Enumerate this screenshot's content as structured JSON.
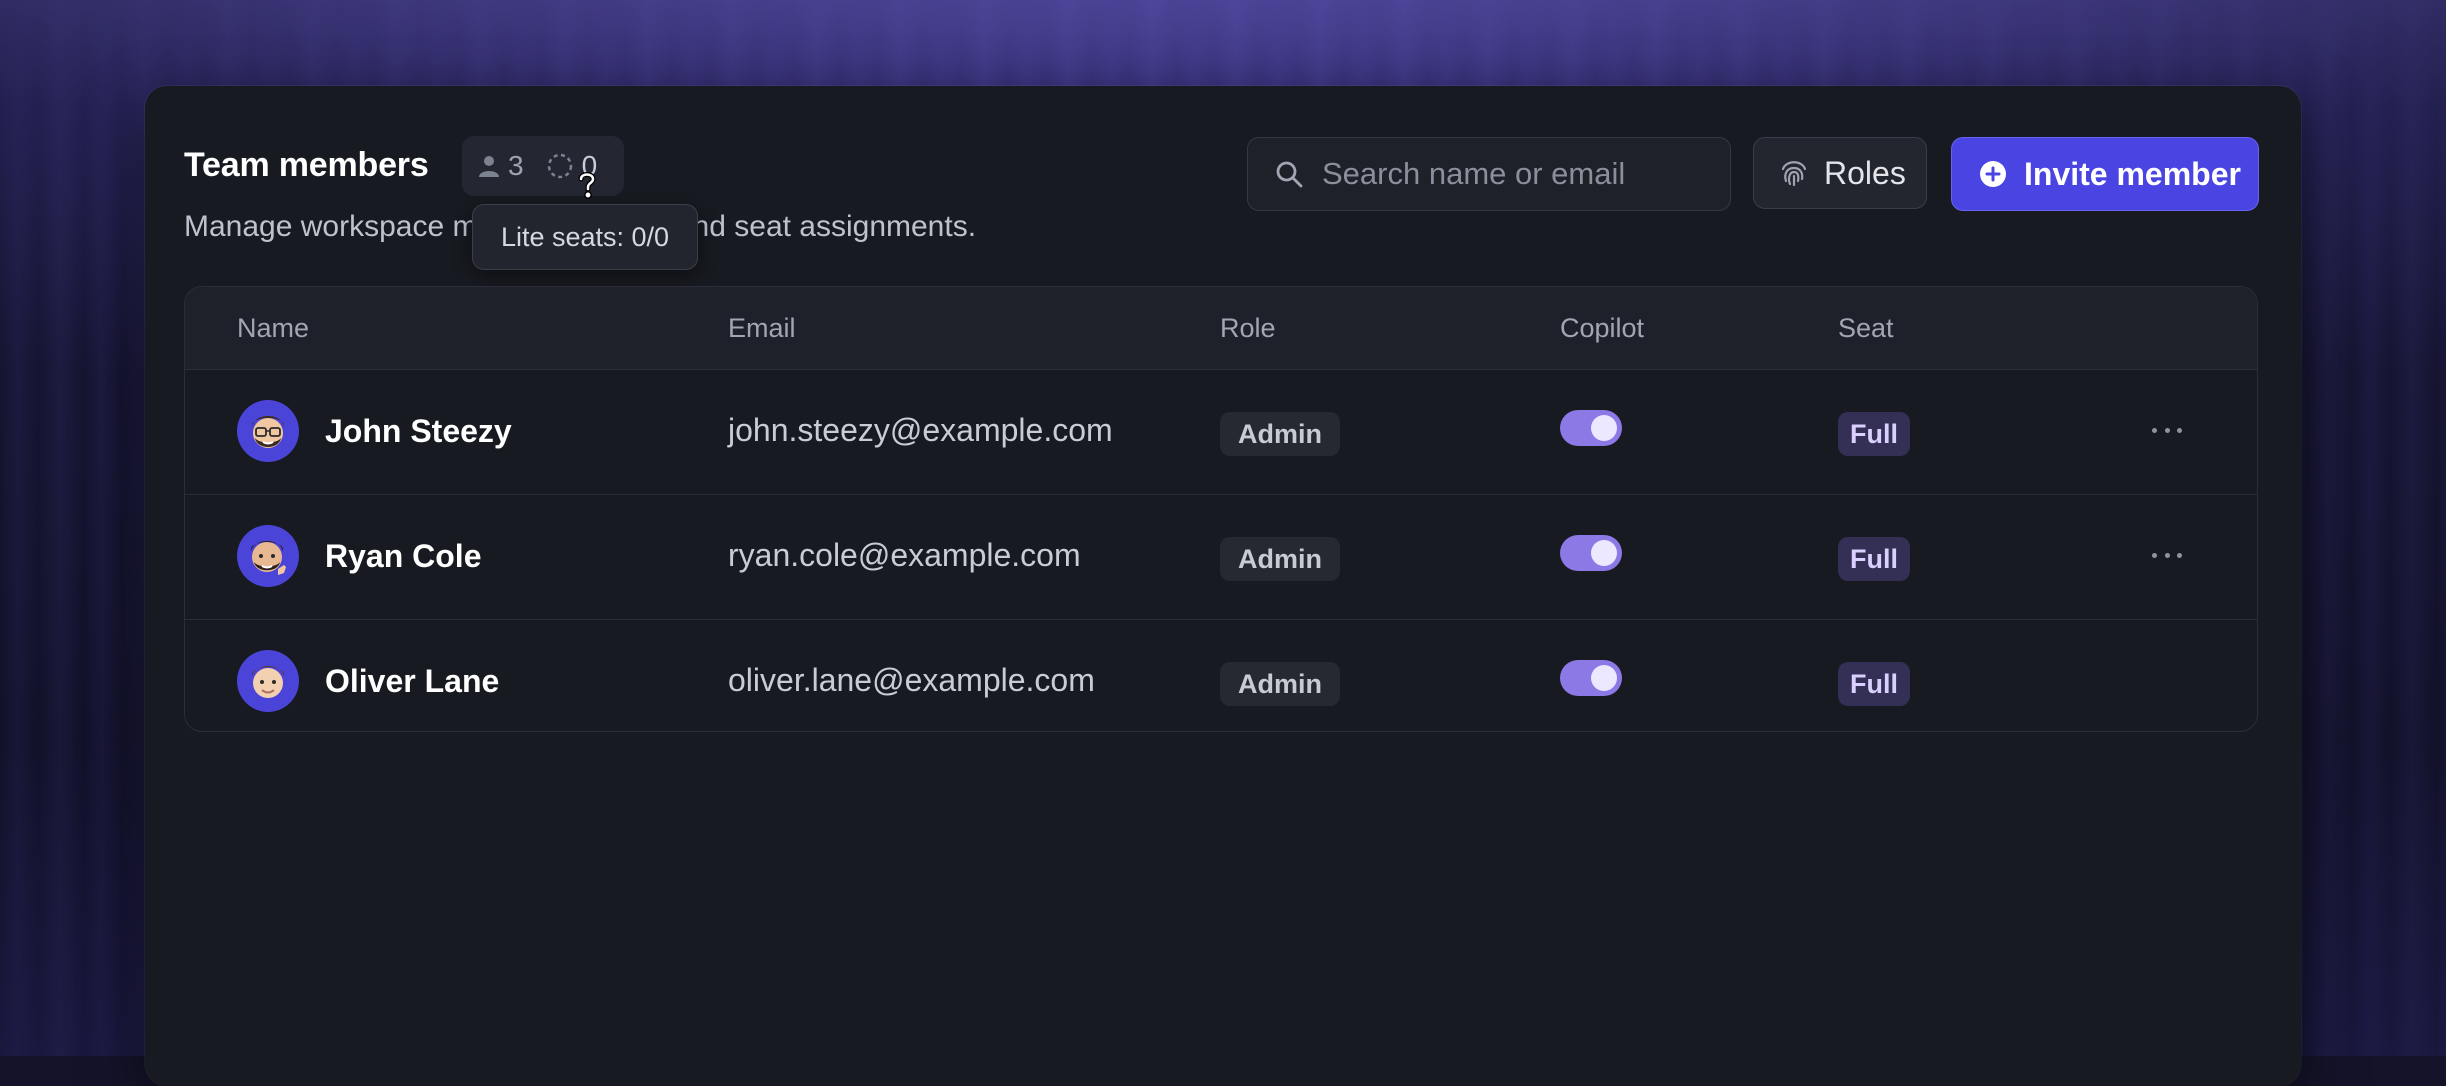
{
  "header": {
    "title": "Team members",
    "member_count": "3",
    "lite_count": "0",
    "subtitle": "Manage workspace members, roles, and seat assignments.",
    "tooltip": "Lite seats: 0/0"
  },
  "search": {
    "placeholder": "Search name or email",
    "value": ""
  },
  "toolbar": {
    "roles_label": "Roles",
    "invite_label": "Invite member"
  },
  "colors": {
    "accent": "#4a45e2",
    "toggle_on": "#8d79e6",
    "card_bg": "#181a21"
  },
  "table": {
    "columns": {
      "name": "Name",
      "email": "Email",
      "role": "Role",
      "copilot": "Copilot",
      "seat": "Seat"
    },
    "rows": [
      {
        "name": "John Steezy",
        "email": "john.steezy@example.com",
        "role": "Admin",
        "copilot": true,
        "seat": "Full",
        "has_menu": true
      },
      {
        "name": "Ryan Cole",
        "email": "ryan.cole@example.com",
        "role": "Admin",
        "copilot": true,
        "seat": "Full",
        "has_menu": true
      },
      {
        "name": "Oliver Lane",
        "email": "oliver.lane@example.com",
        "role": "Admin",
        "copilot": true,
        "seat": "Full",
        "has_menu": false
      }
    ]
  }
}
